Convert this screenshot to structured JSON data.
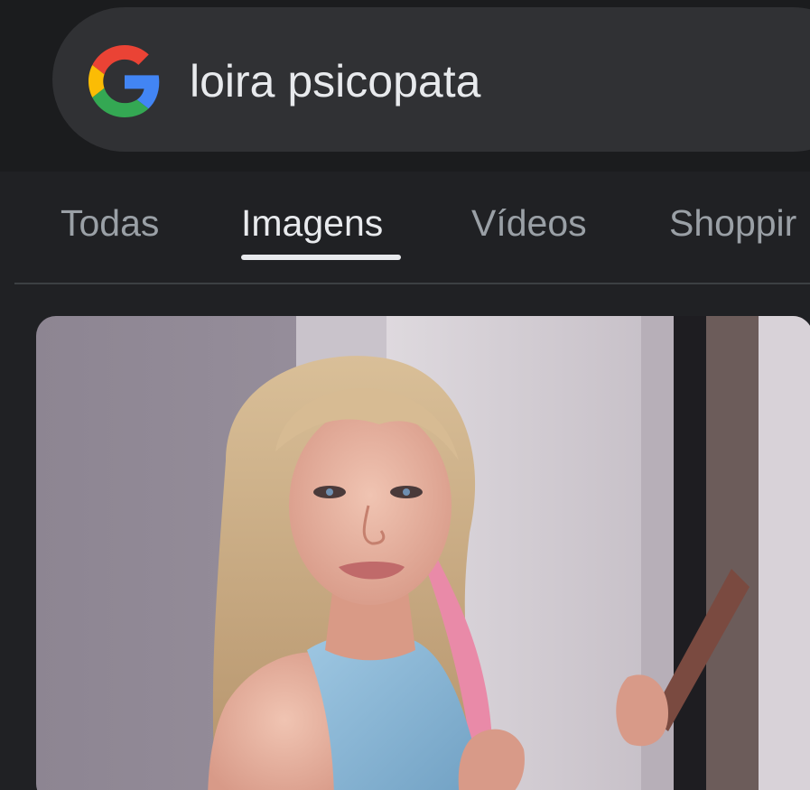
{
  "search": {
    "query": "loira psicopata",
    "logo_icon": "google-g-icon"
  },
  "tabs": [
    {
      "label": "Todas",
      "active": false
    },
    {
      "label": "Imagens",
      "active": true
    },
    {
      "label": "Vídeos",
      "active": false
    },
    {
      "label": "Shoppir",
      "active": false
    }
  ],
  "colors": {
    "background": "#202124",
    "search_bar": "#303134",
    "text_active": "#e8eaed",
    "text_inactive": "#9aa0a6",
    "google_blue": "#4285F4",
    "google_red": "#EA4335",
    "google_yellow": "#FBBC05",
    "google_green": "#34A853"
  },
  "results": [
    {
      "type": "image-thumbnail"
    }
  ]
}
